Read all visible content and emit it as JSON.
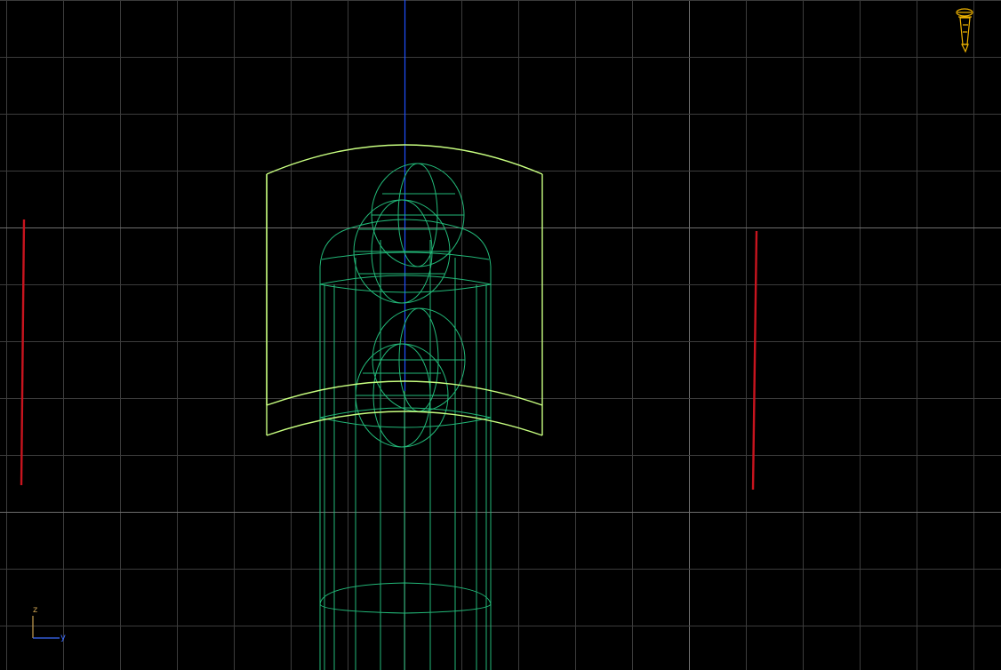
{
  "viewport": {
    "view": "right",
    "background_color": "#000000",
    "grid_color": "#3c3c3c",
    "grid_major_color": "#6e6e6e",
    "selection_color": "#c8ff80",
    "wire_color": "#22b878",
    "vertical_axis_color": "#1e50ff",
    "camera_indicator_color": "#f0b400",
    "wall_plane_color": "#c8141e",
    "icons": [
      "camera-icon",
      "axis-tripod-icon"
    ]
  },
  "axis_indicator": {
    "vertical_label": "z",
    "horizontal_label": "y",
    "vertical_color": "#c8a050",
    "horizontal_color": "#3c6cff"
  }
}
